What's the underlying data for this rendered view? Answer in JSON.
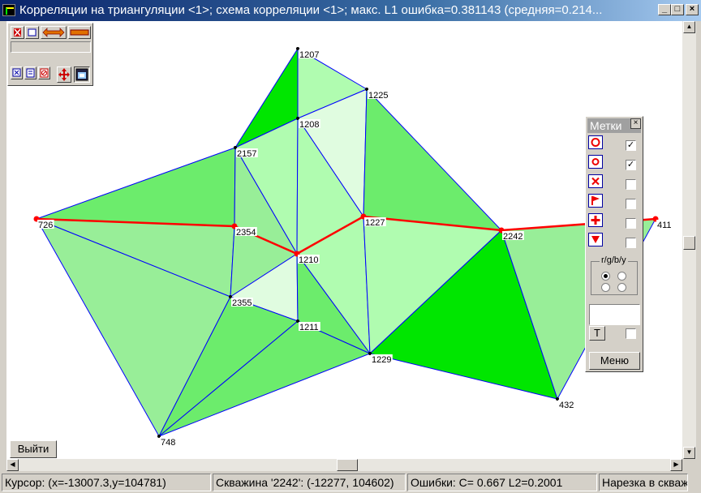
{
  "window": {
    "title": "Корреляции на триангуляции <1>; схема корреляции <1>; макс. L1 ошибка=0.381143 (средняя=0.214...",
    "minimize": "_",
    "maximize": "□",
    "close": "×"
  },
  "map": {
    "wells": [
      {
        "id": "1207"
      },
      {
        "id": "1225"
      },
      {
        "id": "1208"
      },
      {
        "id": "2157"
      },
      {
        "id": "726"
      },
      {
        "id": "2354"
      },
      {
        "id": "1227"
      },
      {
        "id": "2242"
      },
      {
        "id": "411"
      },
      {
        "id": "1210"
      },
      {
        "id": "2355"
      },
      {
        "id": "1211"
      },
      {
        "id": "1229"
      },
      {
        "id": "432"
      },
      {
        "id": "748"
      }
    ],
    "fill_colors": {
      "light": "#e0fce0",
      "pale": "#b0fcb0",
      "mid": "#98ee98",
      "green": "#6cec6c",
      "bright": "#00e600"
    },
    "edge_color": "#0000ff",
    "path_color": "#ff0000"
  },
  "exit_button": "Выйти",
  "marks_panel": {
    "title": "Метки",
    "close": "×",
    "rows": [
      {
        "icon": "circle-icon",
        "checked": true
      },
      {
        "icon": "small-circle-icon",
        "checked": true
      },
      {
        "icon": "x-icon",
        "checked": false
      },
      {
        "icon": "flag-icon",
        "checked": false
      },
      {
        "icon": "cross-icon",
        "checked": false
      },
      {
        "icon": "triangle-icon",
        "checked": false
      }
    ],
    "check_mark": "✓",
    "radio_group_label": "r/g/b/y",
    "text_button": "T",
    "menu_button": "Меню"
  },
  "status": {
    "cursor": "Курсор: (x=-13007.3,y=104781)",
    "well": "Скважина '2242': (-12277, 104602)",
    "errors": "Ошибки: C=  0.667 L2=0.2001",
    "cutting": "Нарезка в скваж"
  }
}
